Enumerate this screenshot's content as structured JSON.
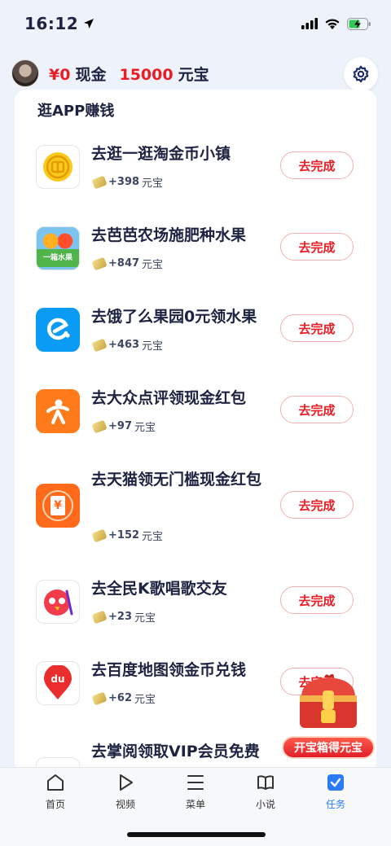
{
  "status": {
    "time": "16:12"
  },
  "header": {
    "cash_amount": "¥0",
    "cash_label": "现金",
    "yuanbao_amount": "15000",
    "yuanbao_label": "元宝"
  },
  "section": {
    "title": "逛APP赚钱"
  },
  "tasks": [
    {
      "title": "去逛一逛淘金币小镇",
      "reward": "+398",
      "unit": "元宝",
      "button": "去完成",
      "icon": "gold-coin-icon"
    },
    {
      "title": "去芭芭农场施肥种水果",
      "reward": "+847",
      "unit": "元宝",
      "button": "去完成",
      "icon": "fruit-box-icon",
      "icon_text": "一箱水果"
    },
    {
      "title": "去饿了么果园0元领水果",
      "reward": "+463",
      "unit": "元宝",
      "button": "去完成",
      "icon": "eleme-icon"
    },
    {
      "title": "去大众点评领现金红包",
      "reward": "+97",
      "unit": "元宝",
      "button": "去完成",
      "icon": "dianping-icon"
    },
    {
      "title": "去天猫领无门槛现金红包",
      "reward": "+152",
      "unit": "元宝",
      "button": "去完成",
      "icon": "tmall-coupon-icon",
      "icon_text": "¥"
    },
    {
      "title": "去全民K歌唱歌交友",
      "reward": "+23",
      "unit": "元宝",
      "button": "去完成",
      "icon": "kge-icon"
    },
    {
      "title": "去百度地图领金币兑钱",
      "reward": "+62",
      "unit": "元宝",
      "button": "去完成",
      "icon": "baidu-map-icon",
      "icon_text": "du"
    },
    {
      "title": "去掌阅领取VIP会员免费",
      "reward": "",
      "unit": "",
      "button": "",
      "icon": "zhangyue-icon"
    }
  ],
  "treasure": {
    "label": "开宝箱得元宝"
  },
  "tabbar": [
    {
      "label": "首页",
      "icon": "home-icon"
    },
    {
      "label": "视频",
      "icon": "play-icon"
    },
    {
      "label": "菜单",
      "icon": "menu-icon"
    },
    {
      "label": "小说",
      "icon": "book-icon"
    },
    {
      "label": "任务",
      "icon": "task-check-icon",
      "active": true
    }
  ],
  "colors": {
    "accent_red": "#ea1c24",
    "active_blue": "#2b7bf5"
  }
}
